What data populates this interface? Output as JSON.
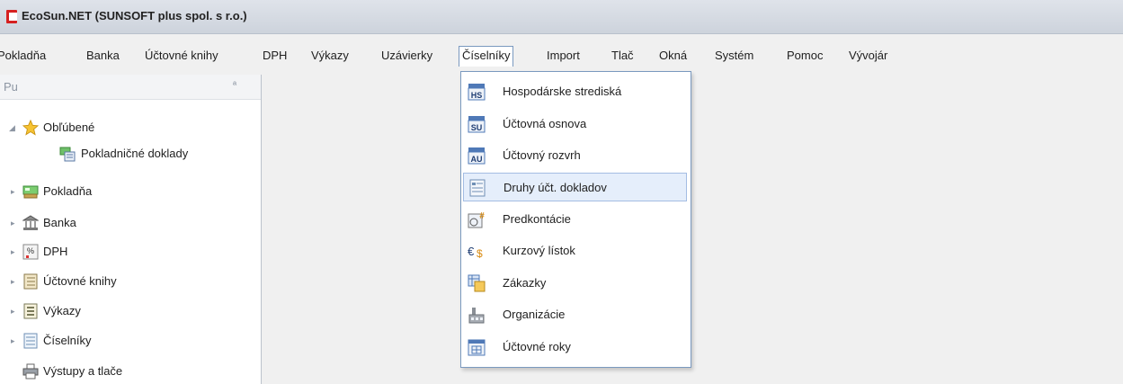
{
  "window": {
    "title": "EcoSun.NET  (SUNSOFT plus spol. s r.o.)"
  },
  "menubar": {
    "items": [
      {
        "label": "Pokladňa"
      },
      {
        "label": "Banka"
      },
      {
        "label": "Účtovné knihy"
      },
      {
        "label": "DPH"
      },
      {
        "label": "Výkazy"
      },
      {
        "label": "Uzávierky"
      },
      {
        "label": "Číselníky"
      },
      {
        "label": "Import"
      },
      {
        "label": "Tlač"
      },
      {
        "label": "Okná"
      },
      {
        "label": "Systém"
      },
      {
        "label": "Pomoc"
      },
      {
        "label": "Vývojár"
      }
    ],
    "open_item": "Číselníky"
  },
  "panel": {
    "title": "Pu",
    "pin_glyph": "ª",
    "tree": [
      {
        "label": "Obľúbené",
        "icon": "star-icon",
        "expanded": true
      },
      {
        "label": "Pokladničné doklady",
        "icon": "cash-document-icon",
        "child": true
      },
      {
        "label": "Pokladňa",
        "icon": "cash-register-icon"
      },
      {
        "label": "Banka",
        "icon": "bank-icon"
      },
      {
        "label": "DPH",
        "icon": "percent-icon"
      },
      {
        "label": "Účtovné knihy",
        "icon": "ledger-icon"
      },
      {
        "label": "Výkazy",
        "icon": "report-icon"
      },
      {
        "label": "Číselníky",
        "icon": "list-icon"
      },
      {
        "label": "Výstupy a tlače",
        "icon": "printer-icon"
      }
    ]
  },
  "dropdown": {
    "items": [
      {
        "label": "Hospodárske strediská",
        "icon": "hs-icon",
        "icon_text": "HS"
      },
      {
        "label": "Účtovná osnova",
        "icon": "su-icon",
        "icon_text": "SU"
      },
      {
        "label": "Účtovný rozvrh",
        "icon": "au-icon",
        "icon_text": "AU"
      },
      {
        "label": "Druhy účt. dokladov",
        "icon": "document-types-icon",
        "highlighted": true
      },
      {
        "label": "Predkontácie",
        "icon": "predkontacie-icon"
      },
      {
        "label": "Kurzový lístok",
        "icon": "currency-icon",
        "icon_text": "€$"
      },
      {
        "label": "Zákazky",
        "icon": "orders-icon"
      },
      {
        "label": "Organizácie",
        "icon": "organization-icon"
      },
      {
        "label": "Účtovné roky",
        "icon": "calendar-icon"
      }
    ]
  },
  "colors": {
    "highlight_bg": "#e5eefb",
    "highlight_border": "#a4bde3",
    "menu_open_border": "#7a99bf"
  }
}
